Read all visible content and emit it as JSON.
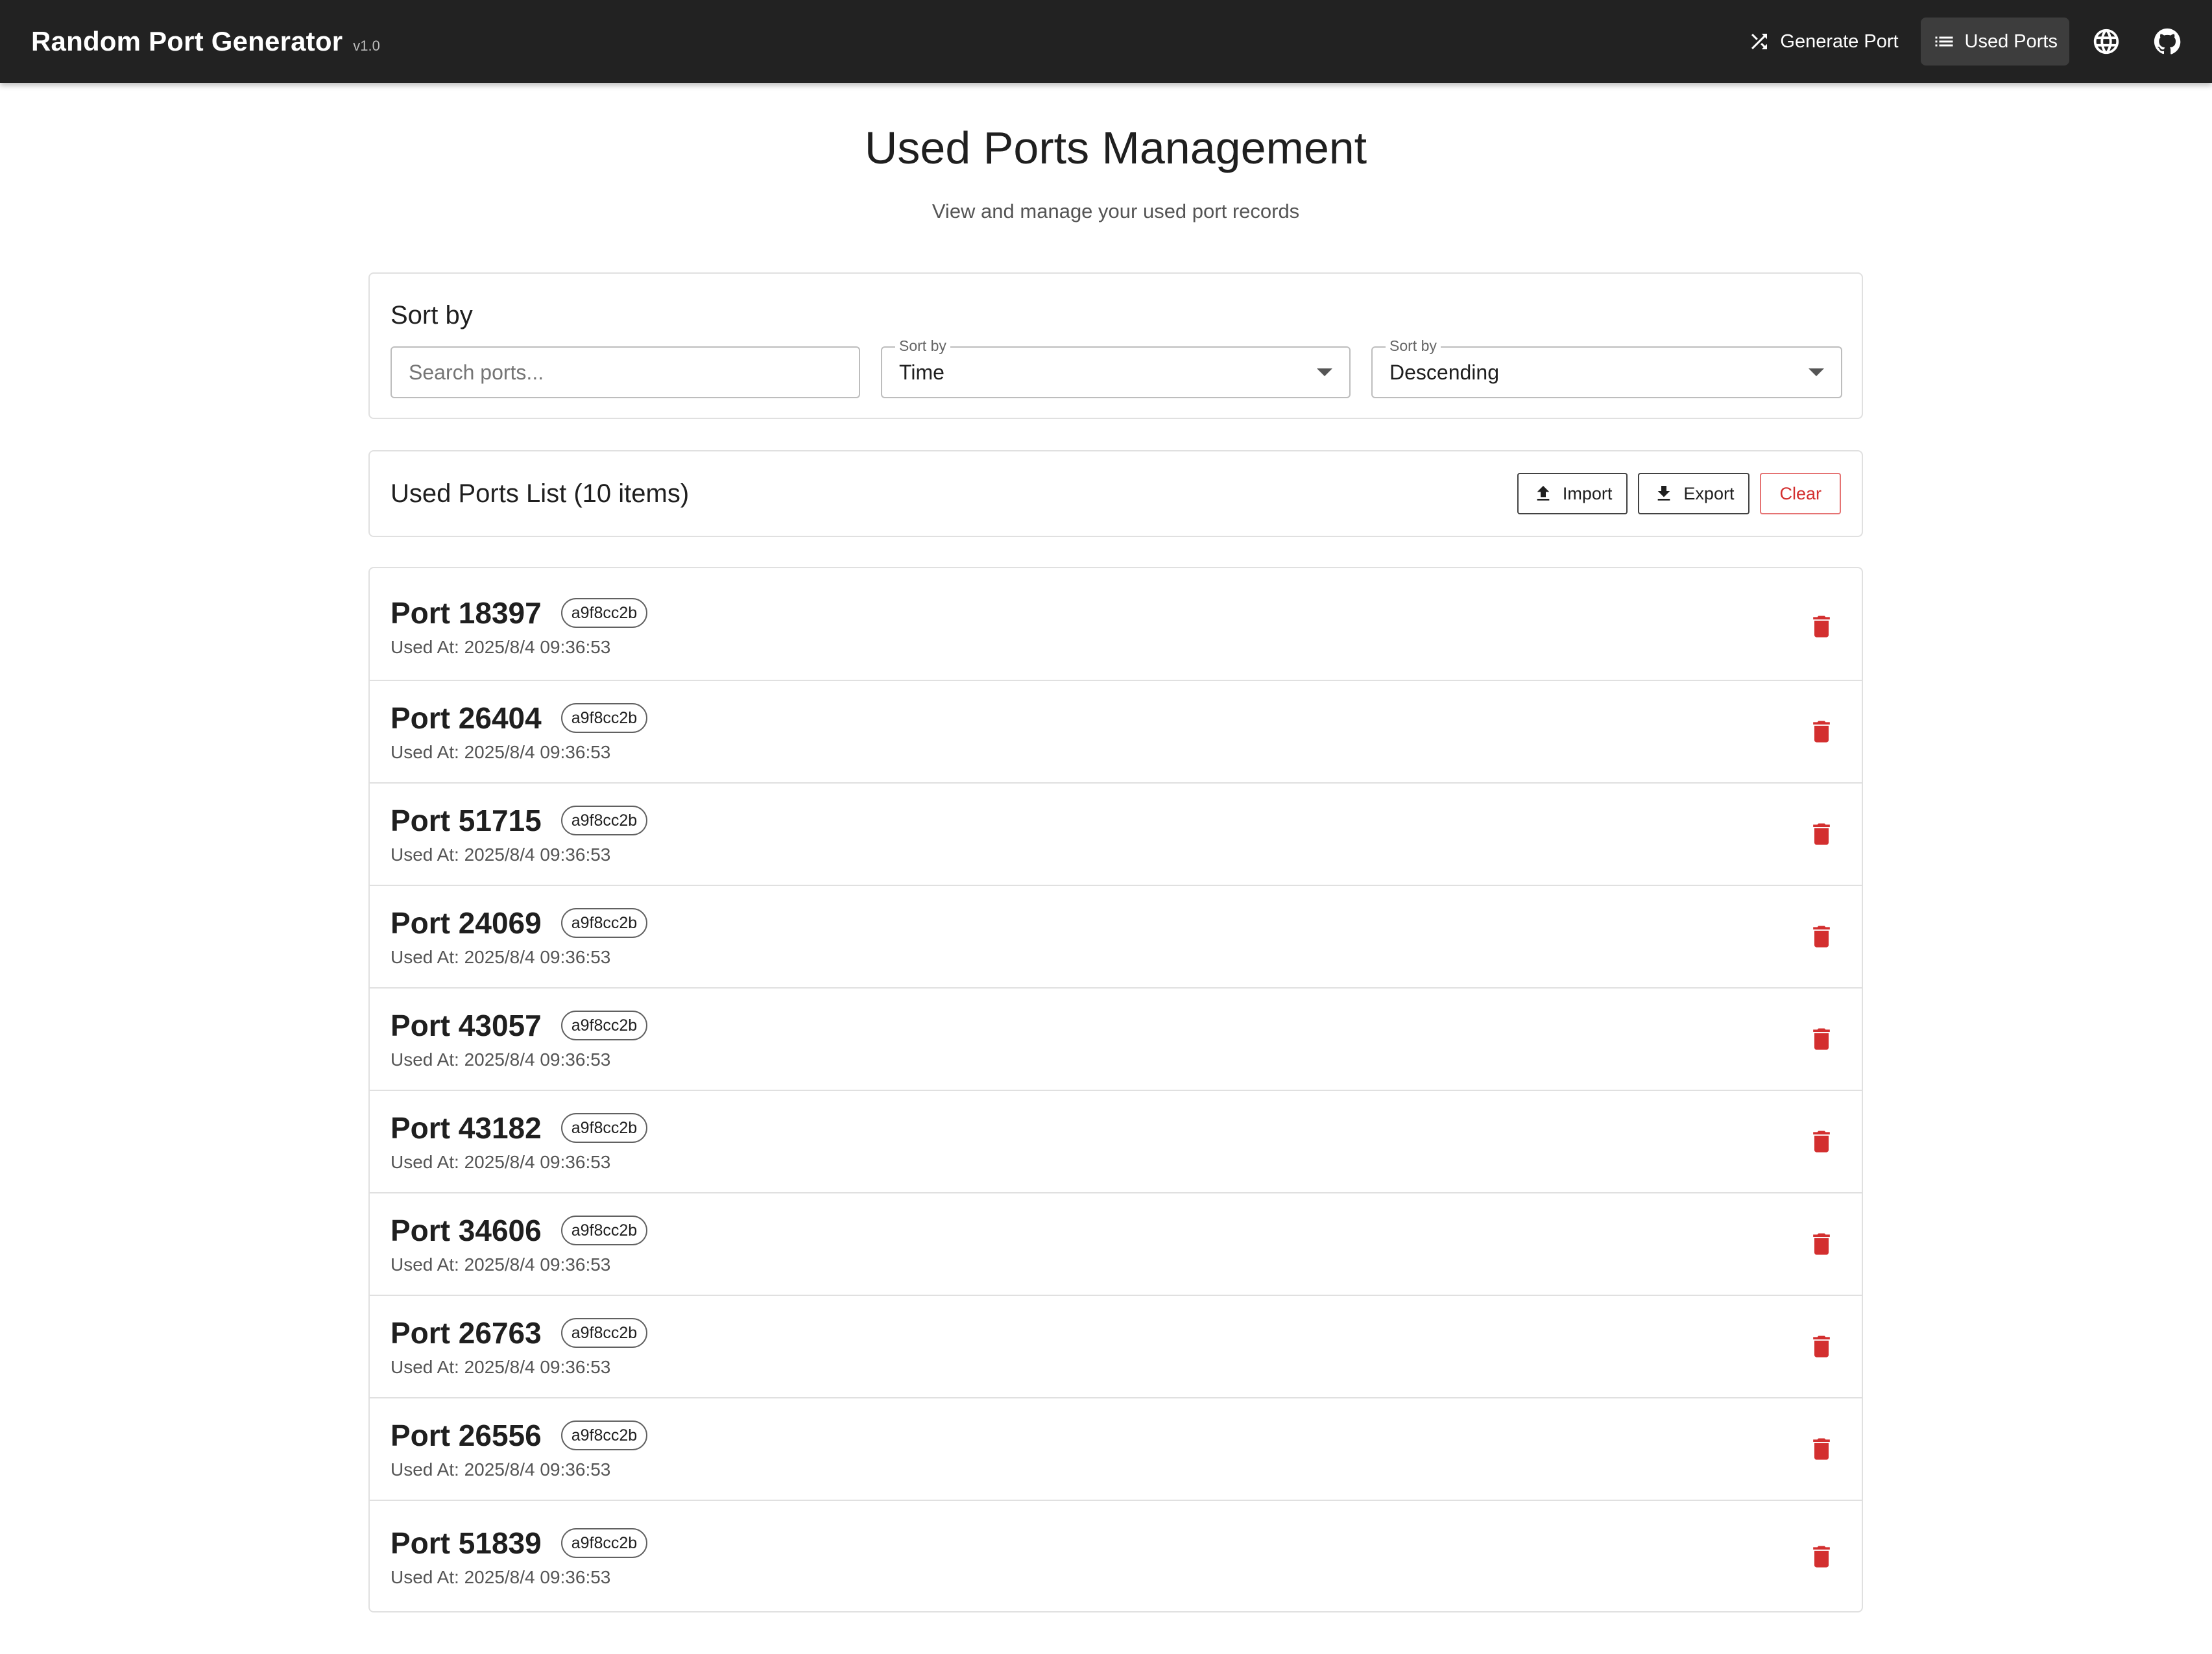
{
  "appbar": {
    "title": "Random Port Generator",
    "version": "v1.0",
    "nav": [
      {
        "label": "Generate Port",
        "icon": "shuffle-icon"
      },
      {
        "label": "Used Ports",
        "icon": "list-icon",
        "active": true
      }
    ],
    "language_icon": "globe-icon",
    "github_icon": "github-icon"
  },
  "page": {
    "title": "Used Ports Management",
    "subtitle": "View and manage your used port records"
  },
  "filters": {
    "heading": "Sort by",
    "search_placeholder": "Search ports...",
    "sort_field": {
      "legend": "Sort by",
      "value": "Time"
    },
    "sort_order": {
      "legend": "Sort by",
      "value": "Descending"
    }
  },
  "list_header": {
    "title": "Used Ports List (10 items)",
    "import_label": "Import",
    "export_label": "Export",
    "clear_label": "Clear"
  },
  "ports": [
    {
      "label": "Port 18397",
      "tag": "a9f8cc2b",
      "used_at": "Used At: 2025/8/4 09:36:53"
    },
    {
      "label": "Port 26404",
      "tag": "a9f8cc2b",
      "used_at": "Used At: 2025/8/4 09:36:53"
    },
    {
      "label": "Port 51715",
      "tag": "a9f8cc2b",
      "used_at": "Used At: 2025/8/4 09:36:53"
    },
    {
      "label": "Port 24069",
      "tag": "a9f8cc2b",
      "used_at": "Used At: 2025/8/4 09:36:53"
    },
    {
      "label": "Port 43057",
      "tag": "a9f8cc2b",
      "used_at": "Used At: 2025/8/4 09:36:53"
    },
    {
      "label": "Port 43182",
      "tag": "a9f8cc2b",
      "used_at": "Used At: 2025/8/4 09:36:53"
    },
    {
      "label": "Port 34606",
      "tag": "a9f8cc2b",
      "used_at": "Used At: 2025/8/4 09:36:53"
    },
    {
      "label": "Port 26763",
      "tag": "a9f8cc2b",
      "used_at": "Used At: 2025/8/4 09:36:53"
    },
    {
      "label": "Port 26556",
      "tag": "a9f8cc2b",
      "used_at": "Used At: 2025/8/4 09:36:53"
    },
    {
      "label": "Port 51839",
      "tag": "a9f8cc2b",
      "used_at": "Used At: 2025/8/4 09:36:53"
    }
  ],
  "colors": {
    "appbar_bg": "#222222",
    "danger": "#d32f2f",
    "border": "#e0e0e0"
  }
}
